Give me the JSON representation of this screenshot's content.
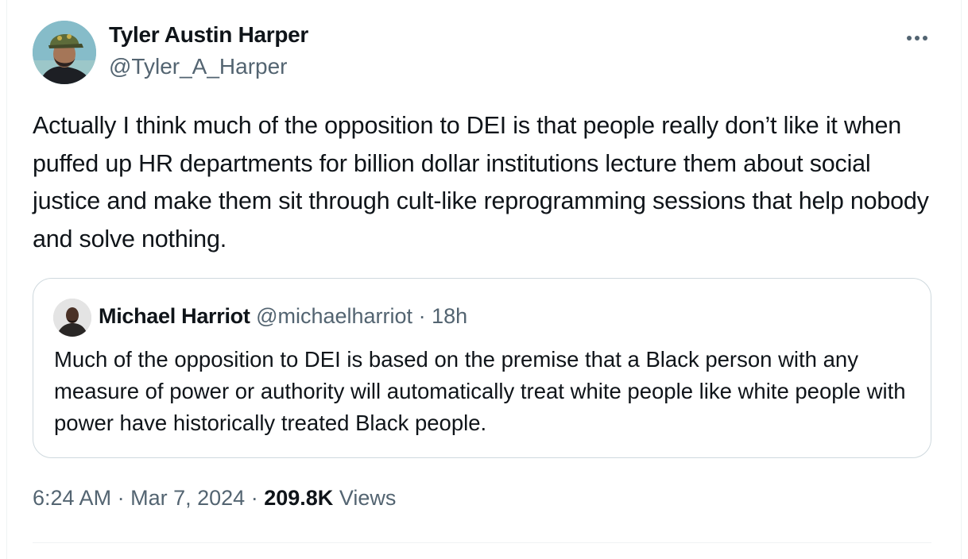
{
  "author": {
    "name": "Tyler Austin Harper",
    "handle": "@Tyler_A_Harper",
    "avatar_icon": "avatar-photo-icon"
  },
  "more_menu": {
    "icon": "more-horizontal-icon"
  },
  "tweet": {
    "text": "Actually I think much of the opposition to DEI is that people really don’t like it when puffed up HR departments for billion dollar institutions lecture them about social justice and make them sit through cult-like reprogramming sessions that help nobody and solve nothing."
  },
  "quote": {
    "name": "Michael Harriot",
    "handle": "@michaelharriot",
    "separator": "·",
    "age": "18h",
    "text": "Much of the opposition to DEI is based on the premise that a Black person with any measure of power or authority will automatically treat white people like white people with power have historically treated Black people."
  },
  "meta": {
    "time": "6:24 AM",
    "sep1": "·",
    "date": "Mar 7, 2024",
    "sep2": "·",
    "views_count": "209.8K",
    "views_label": "Views"
  },
  "colors": {
    "text_primary": "#0f1419",
    "text_secondary": "#536471",
    "border": "#cfd9de",
    "divider": "#eff3f4"
  }
}
